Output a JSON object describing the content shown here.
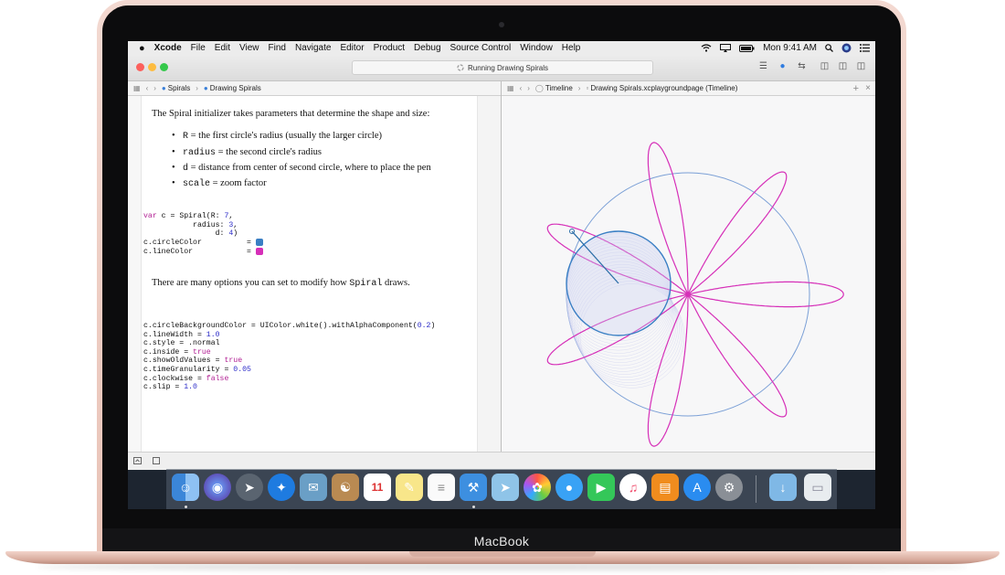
{
  "device": {
    "label": "MacBook"
  },
  "menubar": {
    "apple": "",
    "app": "Xcode",
    "items": [
      "File",
      "Edit",
      "View",
      "Find",
      "Navigate",
      "Editor",
      "Product",
      "Debug",
      "Source Control",
      "Window",
      "Help"
    ],
    "clock": "Mon 9:41 AM"
  },
  "toolbar": {
    "status": "Running Drawing Spirals"
  },
  "left_jump": {
    "crumbs": [
      "Spirals",
      "Drawing Spirals"
    ]
  },
  "right_jump": {
    "crumbs": [
      "Timeline",
      "Drawing Spirals.xcplaygroundpage (Timeline)"
    ]
  },
  "doc": {
    "intro": "The Spiral initializer takes parameters that determine the shape and size:",
    "bullets": [
      {
        "code": "R",
        "text": " = the first circle's radius (usually the larger circle)"
      },
      {
        "code": "radius",
        "text": " = the second circle's radius"
      },
      {
        "code": "d",
        "text": " = distance from center of second circle, where to place the pen"
      },
      {
        "code": "scale",
        "text": " = zoom factor"
      }
    ],
    "code1": {
      "l1a": "var",
      "l1b": " c = Spiral(R: ",
      "l1c": "7",
      "l1d": ",",
      "l2a": "           radius: ",
      "l2b": "3",
      "l2c": ",",
      "l3a": "                d: ",
      "l3b": "4",
      "l3c": ")",
      "l4": "c.circleColor          = ",
      "l5": "c.lineColor            = "
    },
    "middle_a": "There are many options you can set to modify how ",
    "middle_code": "Spiral",
    "middle_b": " draws.",
    "code2": [
      {
        "a": "c.circleBackgroundColor = UIColor.white().withAlphaComponent(",
        "v": "0.2",
        "b": ")",
        "k": "num"
      },
      {
        "a": "c.lineWidth = ",
        "v": "1.0",
        "b": "",
        "k": "num"
      },
      {
        "a": "c.style = .normal",
        "v": "",
        "b": "",
        "k": "num"
      },
      {
        "a": "c.inside = ",
        "v": "true",
        "b": "",
        "k": "kw"
      },
      {
        "a": "c.showOldValues = ",
        "v": "true",
        "b": "",
        "k": "kw"
      },
      {
        "a": "c.timeGranularity = ",
        "v": "0.05",
        "b": "",
        "k": "num"
      },
      {
        "a": "c.clockwise = ",
        "v": "false",
        "b": "",
        "k": "kw"
      },
      {
        "a": "c.slip = ",
        "v": "1.0",
        "b": "",
        "k": "num"
      }
    ]
  },
  "colors": {
    "circle": "#3a7fc4",
    "line": "#d62fb8",
    "bigcircle": "#7a9fd6"
  },
  "spiral": {
    "R": 7,
    "radius": 3,
    "d": 4
  }
}
